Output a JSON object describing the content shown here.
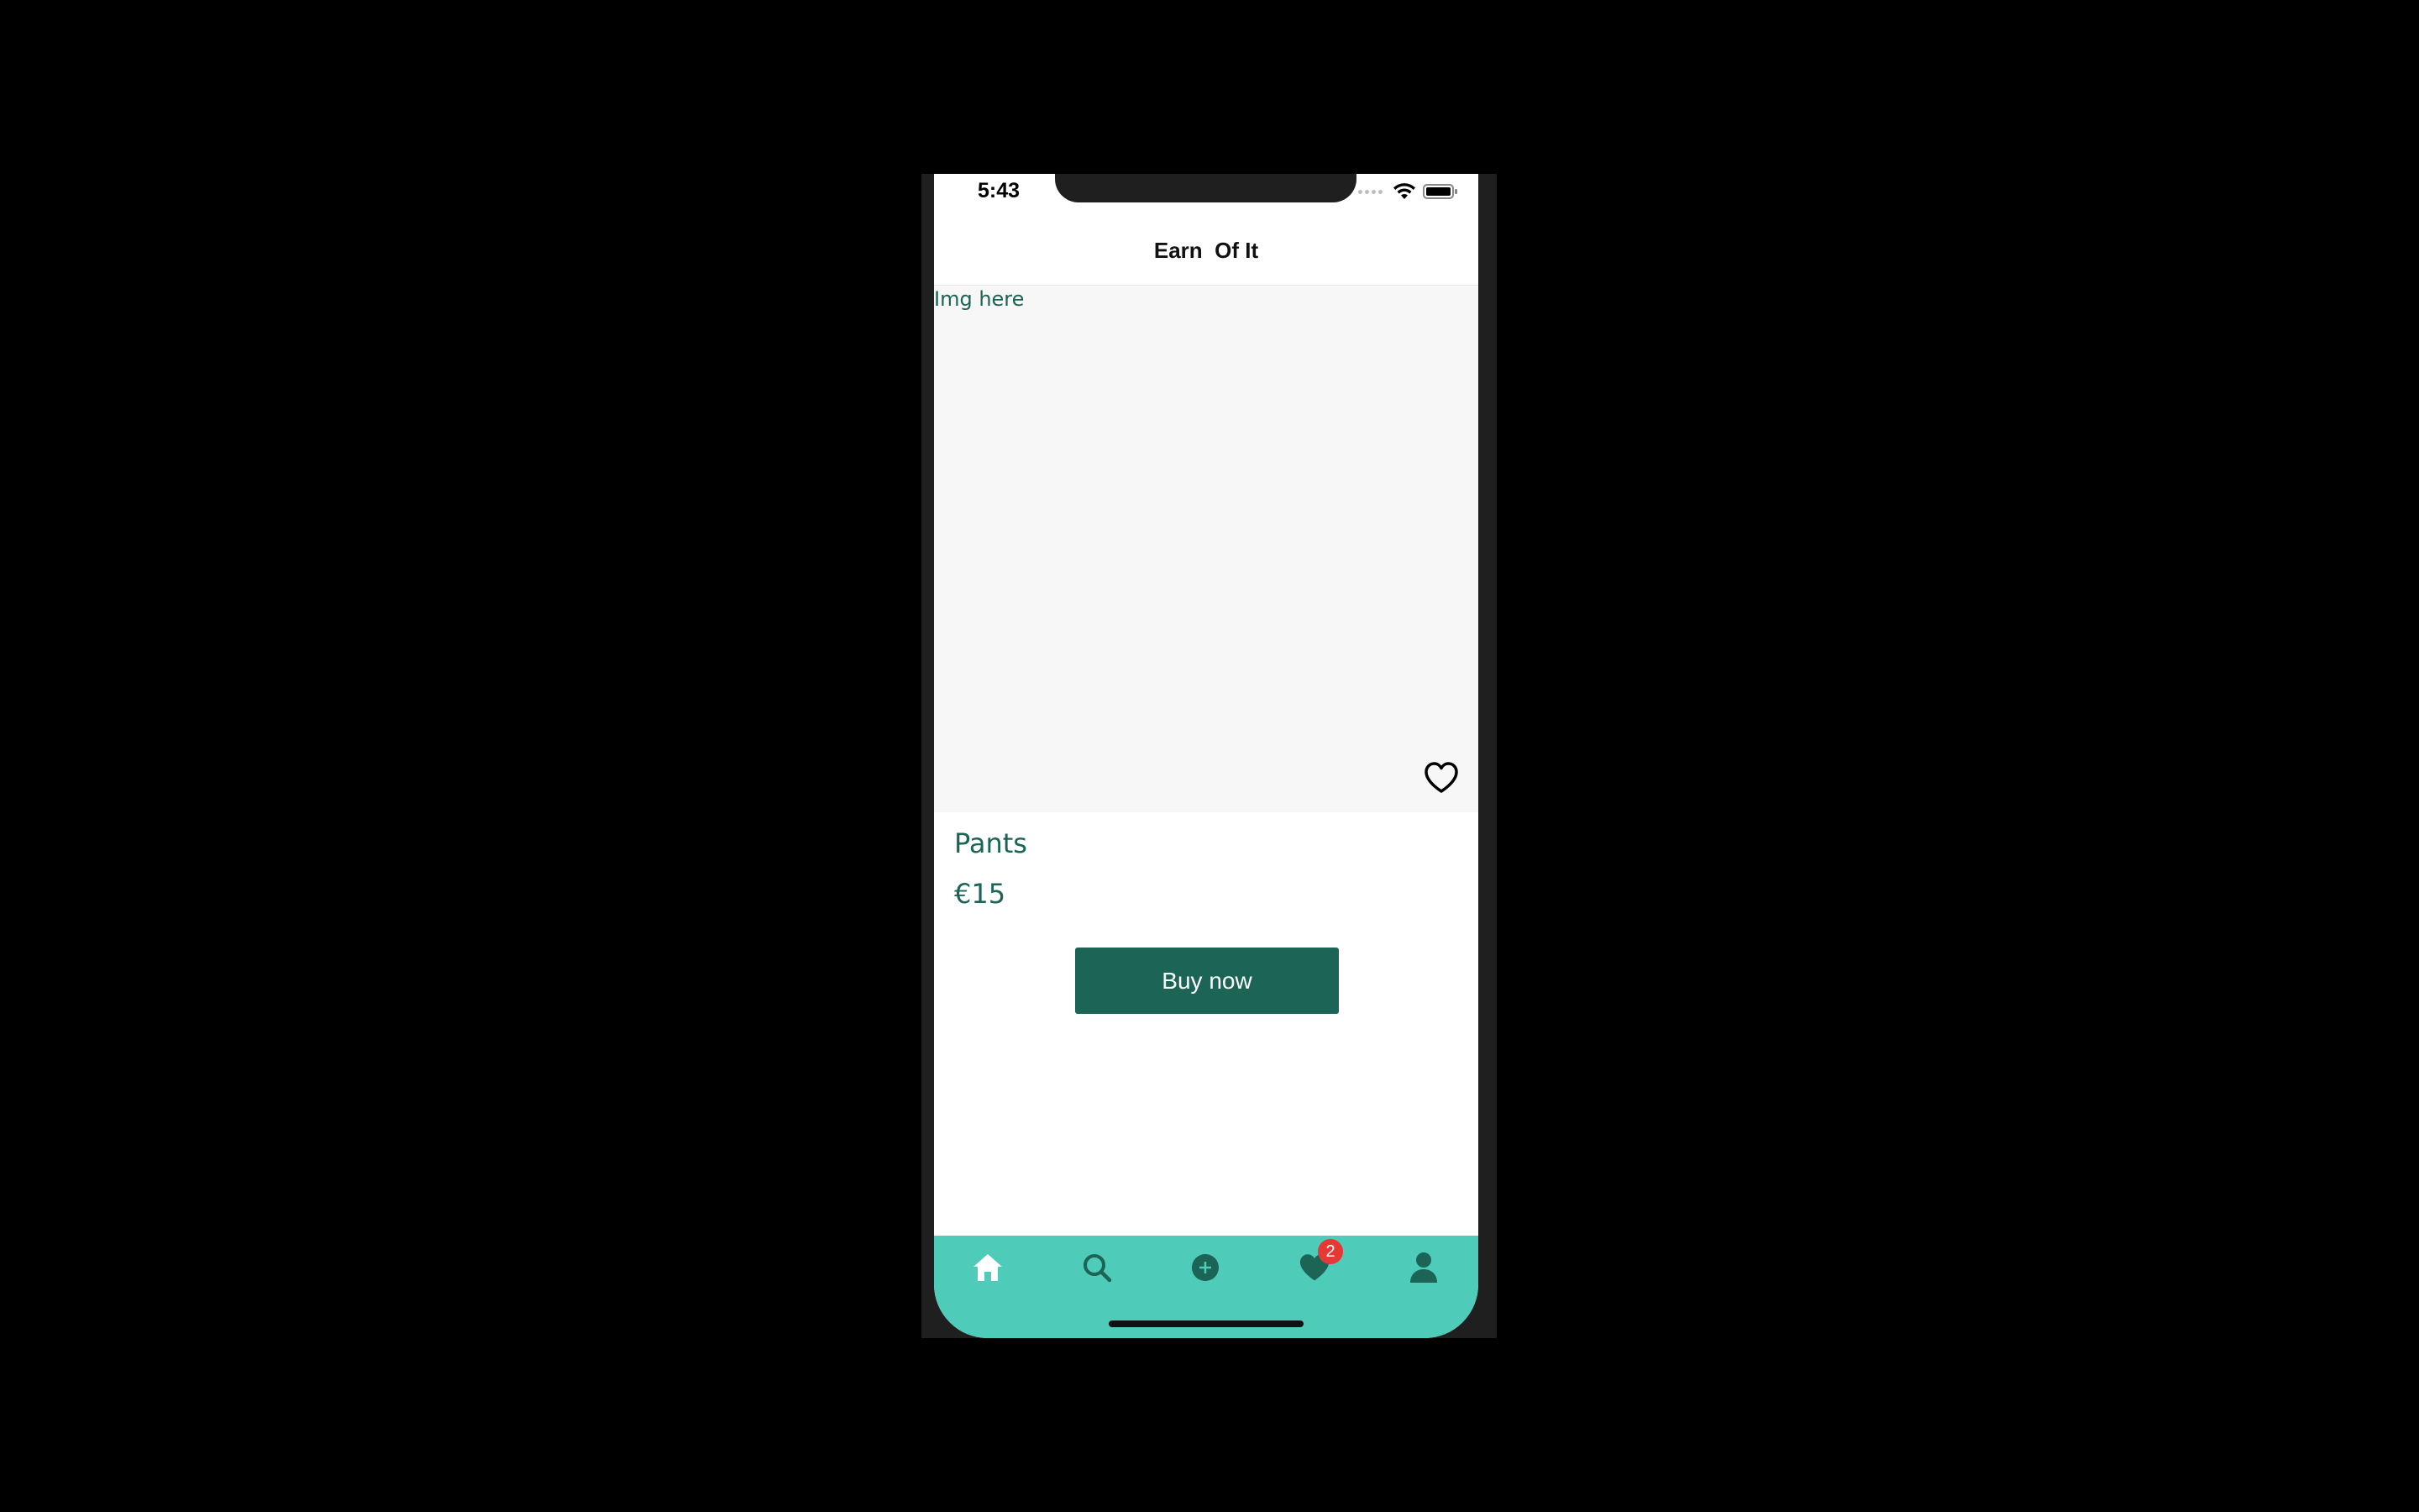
{
  "status_bar": {
    "time": "5:43",
    "icons": [
      "cellular-dots-icon",
      "wifi-icon",
      "battery-icon"
    ]
  },
  "header": {
    "title": "Earn  Of It"
  },
  "product": {
    "image_placeholder": "Img here",
    "favorite_icon": "heart-outline-icon",
    "name": "Pants",
    "price": "€15",
    "buy_label": "Buy now"
  },
  "tab_bar": {
    "background": "#4ecbb9",
    "active_color": "#ffffff",
    "inactive_color": "#1b6456",
    "tabs": [
      {
        "icon": "home-icon",
        "active": true
      },
      {
        "icon": "search-icon",
        "active": false
      },
      {
        "icon": "add-circle-icon",
        "active": false
      },
      {
        "icon": "heart-icon",
        "active": false,
        "badge": "2"
      },
      {
        "icon": "person-icon",
        "active": false
      }
    ]
  },
  "colors": {
    "primary": "#1b6456",
    "accent": "#4ecbb9",
    "badge": "#e53935"
  }
}
